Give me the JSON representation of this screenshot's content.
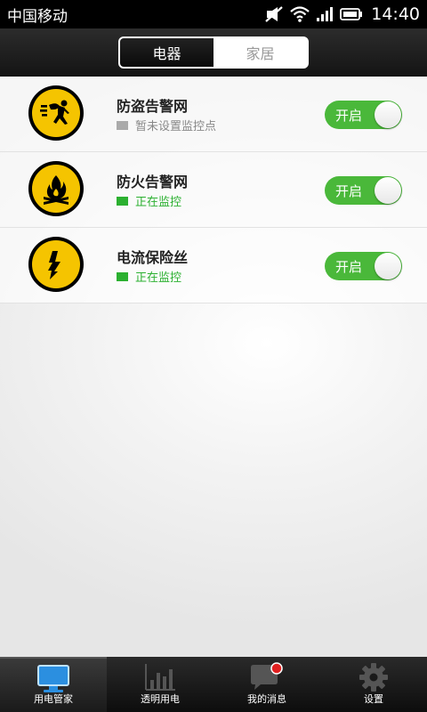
{
  "status_bar": {
    "carrier": "中国移动",
    "time": "14:40"
  },
  "header": {
    "tabs": [
      {
        "label": "电器",
        "active": true
      },
      {
        "label": "家居",
        "active": false
      }
    ]
  },
  "devices": [
    {
      "title": "防盗告警网",
      "status": "暂未设置监控点",
      "status_state": "idle",
      "toggle_label": "开启",
      "icon": "burglar-icon"
    },
    {
      "title": "防火告警网",
      "status": "正在监控",
      "status_state": "active",
      "toggle_label": "开启",
      "icon": "fire-icon"
    },
    {
      "title": "电流保险丝",
      "status": "正在监控",
      "status_state": "active",
      "toggle_label": "开启",
      "icon": "lightning-icon"
    }
  ],
  "bottom_nav": [
    {
      "label": "用电管家",
      "icon": "monitor-icon",
      "active": true
    },
    {
      "label": "透明用电",
      "icon": "bar-chart-icon",
      "active": false
    },
    {
      "label": "我的消息",
      "icon": "message-icon",
      "active": false
    },
    {
      "label": "设置",
      "icon": "gear-icon",
      "active": false
    }
  ],
  "colors": {
    "toggle_on": "#4ab83a",
    "icon_yellow": "#f5c400",
    "monitor_blue": "#2b8fe0",
    "status_active": "#2bb030"
  }
}
